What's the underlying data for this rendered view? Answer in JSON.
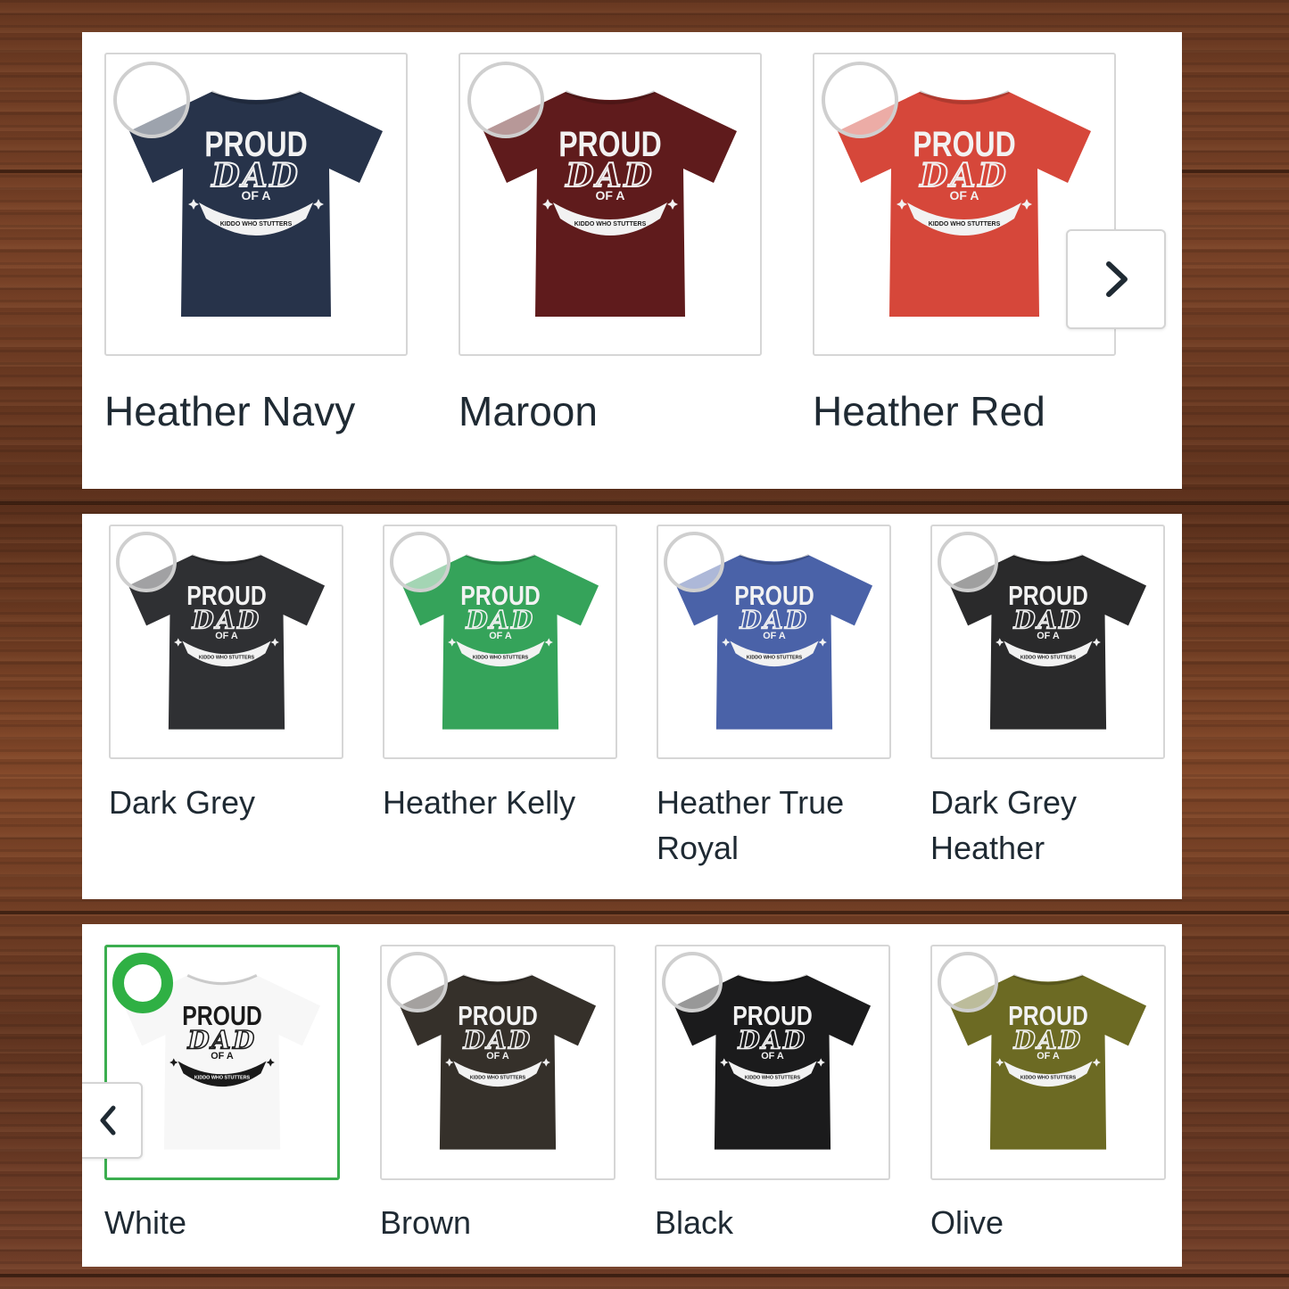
{
  "palette": {
    "selected_accent": "#2fb044",
    "text": "#1f2a33"
  },
  "panels": [
    {
      "swatches": [
        {
          "label": "Heather Navy",
          "shirt_color": "#27334a",
          "selected": false
        },
        {
          "label": "Maroon",
          "shirt_color": "#5f1b1c",
          "selected": false
        },
        {
          "label": "Heather Red",
          "shirt_color": "#d6473a",
          "selected": false
        }
      ],
      "nav": {
        "icon": "chevron-right-icon"
      }
    },
    {
      "swatches": [
        {
          "label": "Dark Grey",
          "shirt_color": "#2f3033",
          "selected": false
        },
        {
          "label": "Heather Kelly",
          "shirt_color": "#35a35a",
          "selected": false
        },
        {
          "label": "Heather True Royal",
          "shirt_color": "#4a62a8",
          "selected": false
        },
        {
          "label": "Dark Grey Heather",
          "shirt_color": "#2a2a2b",
          "selected": false
        }
      ]
    },
    {
      "swatches": [
        {
          "label": "White",
          "shirt_color": "#f7f7f7",
          "selected": true
        },
        {
          "label": "Brown",
          "shirt_color": "#35302a",
          "selected": false
        },
        {
          "label": "Black",
          "shirt_color": "#1b1b1c",
          "selected": false
        },
        {
          "label": "Olive",
          "shirt_color": "#6c6a23",
          "selected": false
        }
      ],
      "nav": {
        "icon": "chevron-left-icon"
      }
    }
  ],
  "shirt_print": {
    "line1": "PROUD",
    "line2": "DAD",
    "line3": "OF A",
    "banner": "KIDDO WHO STUTTERS"
  }
}
